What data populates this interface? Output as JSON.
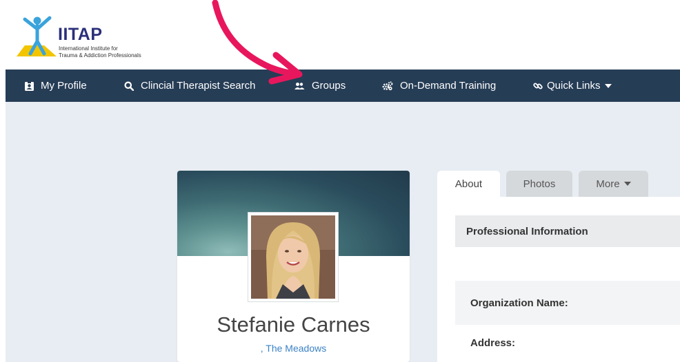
{
  "logo": {
    "title": "IITAP",
    "subtitle_line1": "International Institute for",
    "subtitle_line2": "Trauma & Addiction Professionals",
    "colors": {
      "text": "#2b2f7a",
      "figure": "#3aa3dc",
      "accent": "#f2c500"
    }
  },
  "nav": {
    "background": "#263d56",
    "items": [
      {
        "label": "My Profile",
        "icon": "id-badge-icon"
      },
      {
        "label": "Clincial Therapist Search",
        "icon": "search-icon"
      },
      {
        "label": "Groups",
        "icon": "users-icon"
      },
      {
        "label": "On-Demand Training",
        "icon": "gears-icon"
      },
      {
        "label": "Quick Links",
        "icon": "link-icon",
        "dropdown": true
      }
    ]
  },
  "annotation": {
    "type": "arrow",
    "color": "#e8175d",
    "points_to": "Groups"
  },
  "profile": {
    "name": "Stefanie Carnes",
    "organization": ", The Meadows",
    "org_color": "#3b82c4"
  },
  "tabs": [
    {
      "label": "About",
      "active": true
    },
    {
      "label": "Photos",
      "active": false
    },
    {
      "label": "More",
      "active": false,
      "dropdown": true
    }
  ],
  "about": {
    "section_title": "Professional Information",
    "fields": [
      {
        "label": "Organization Name:"
      },
      {
        "label": "Address:"
      }
    ]
  }
}
